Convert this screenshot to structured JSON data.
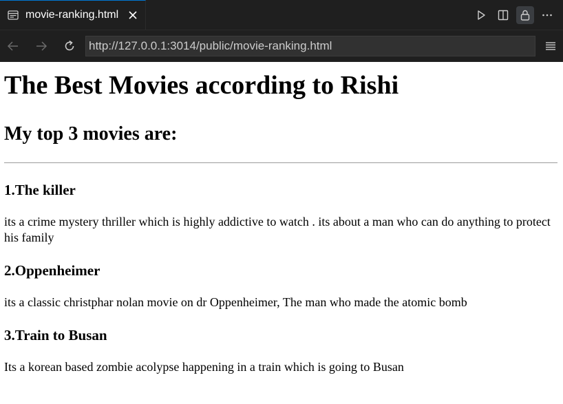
{
  "tab": {
    "title": "movie-ranking.html",
    "icon": "preview-icon",
    "close_icon": "close-icon"
  },
  "tab_actions": [
    "run-icon",
    "split-editor-icon",
    "lock-icon",
    "more-icon"
  ],
  "navigation": {
    "url": "http://127.0.0.1:3014/public/movie-ranking.html"
  },
  "colors": {
    "chrome_bg": "#1f1f1f",
    "tab_accent": "#0078d4",
    "url_bg": "#313131",
    "page_bg": "#ffffff"
  },
  "page": {
    "title": "The Best Movies according to Rishi",
    "subtitle": "My top 3 movies are:",
    "movies": [
      {
        "heading": "1.The killer",
        "description": "its a crime mystery thriller which is highly addictive to watch . its about a man who can do anything to protect his family"
      },
      {
        "heading": "2.Oppenheimer",
        "description": "its a classic christphar nolan movie on dr Oppenheimer, The man who made the atomic bomb"
      },
      {
        "heading": "3.Train to Busan",
        "description": "Its a korean based zombie acolypse happening in a train which is going to Busan"
      }
    ]
  }
}
